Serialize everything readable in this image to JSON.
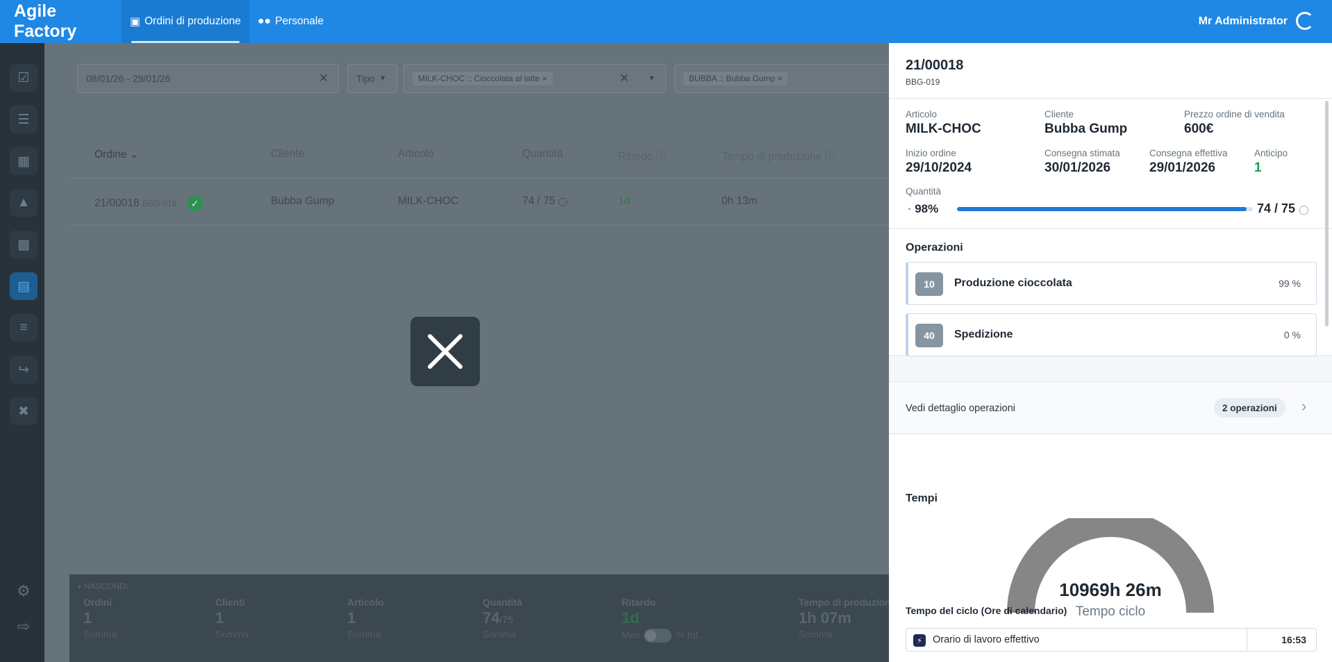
{
  "app": {
    "brand": "Agile Factory",
    "tabs": [
      {
        "label": "Ordini di produzione",
        "icon": "box-icon",
        "active": true
      },
      {
        "label": "Personale",
        "icon": "users-icon",
        "active": false
      }
    ],
    "user": "Mr Administrator"
  },
  "filters": {
    "date_range": "08/01/26 - 29/01/26",
    "tipo": "Tipo",
    "articolo_chip": "MILK-CHOC :: Cioccolata al latte",
    "cliente_chip": "BUBBA :: Bubba Gump"
  },
  "table": {
    "headers": {
      "ordine": "Ordine",
      "cliente": "Cliente",
      "articolo": "Articolo",
      "quantita": "Quantità",
      "ritardo": "Ritardo",
      "tempo": "Tempo di produzione"
    },
    "rows": [
      {
        "ordine": "21/00018",
        "code": "BBG-019",
        "cliente": "Bubba Gump",
        "articolo": "MILK-CHOC",
        "quantita": "74 / 75",
        "ritardo": "1d",
        "tempo": "0h 13m"
      }
    ]
  },
  "footer": {
    "hide_label": "NASCONDI",
    "ordini": {
      "label": "Ordini",
      "value": "1",
      "sub": "Somma"
    },
    "clienti": {
      "label": "Clienti",
      "value": "1",
      "sub": "Somma"
    },
    "articolo": {
      "label": "Articolo",
      "value": "1",
      "sub": "Somma"
    },
    "quantita": {
      "label": "Quantità",
      "value": "74",
      "total": "/75",
      "sub": "Somma"
    },
    "ritardo": {
      "label": "Ritardo",
      "value": "1d",
      "max": "Max",
      "pct": "% tot."
    },
    "tempo": {
      "label": "Tempo di produzione",
      "value": "1h 07m",
      "sub": "Somma"
    }
  },
  "panel": {
    "order_id": "21/00018",
    "order_code": "BBG-019",
    "articolo": {
      "label": "Articolo",
      "value": "MILK-CHOC"
    },
    "cliente": {
      "label": "Cliente",
      "value": "Bubba Gump"
    },
    "prezzo": {
      "label": "Prezzo ordine di vendita",
      "value": "600€"
    },
    "inizio": {
      "label": "Inizio ordine",
      "value": "29/10/2024"
    },
    "consegna_stimata": {
      "label": "Consegna stimata",
      "value": "30/01/2026"
    },
    "consegna_effettiva": {
      "label": "Consegna effettiva",
      "value": "29/01/2026"
    },
    "anticipo": {
      "label": "Anticipo",
      "value": "1"
    },
    "quantita": {
      "label": "Quantità",
      "percent_text": "98%",
      "progress": 0.98,
      "value": "74 / 75"
    },
    "operazioni": {
      "title": "Operazioni",
      "items": [
        {
          "num": "10",
          "name": "Produzione cioccolata",
          "pct": "99 %"
        },
        {
          "num": "40",
          "name": "Spedizione",
          "pct": "0 %"
        }
      ]
    },
    "detail": {
      "label": "Vedi dettaglio operazioni",
      "badge": "2 operazioni"
    },
    "tempi": {
      "title": "Tempi",
      "gauge_value": "10969h 26m",
      "gauge_label": "Tempo ciclo",
      "ciclo_title": "Tempo del ciclo (Ore di calendario)",
      "rows": [
        {
          "label": "Orario di lavoro effettivo",
          "value": "16:53"
        }
      ]
    }
  },
  "colors": {
    "topbar": "#1f88e5",
    "progress": "#1f7ad6",
    "gauge": "#868686",
    "green": "#16a34a"
  }
}
